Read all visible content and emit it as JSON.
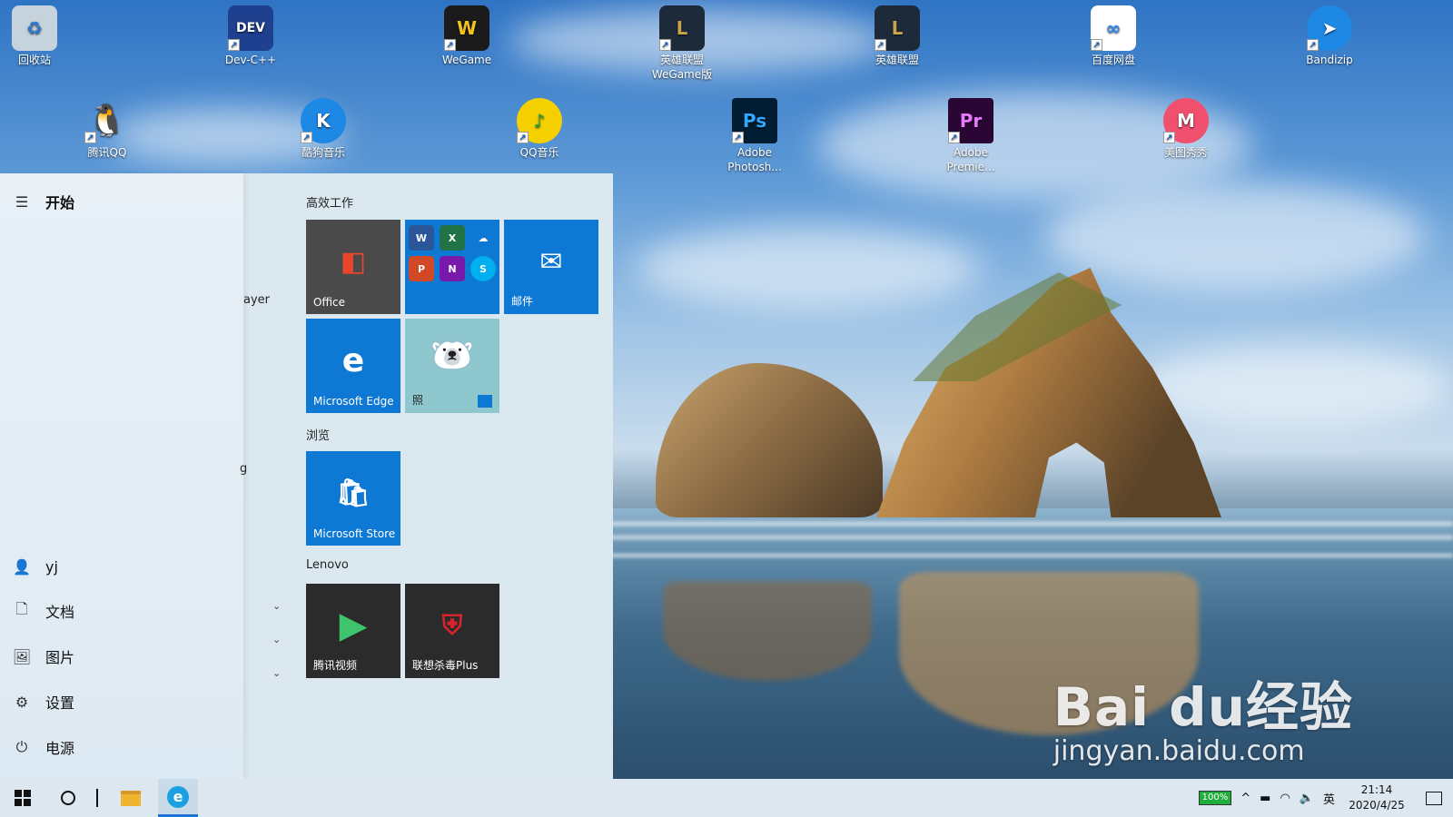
{
  "desktop_icons": [
    {
      "label": "回收站",
      "icon": "recycle-bin-icon",
      "color": "#c7d3dc"
    },
    {
      "label": "Dev-C++",
      "icon": "devcpp-icon",
      "color": "#1f3f8f"
    },
    {
      "label": "WeGame",
      "icon": "wegame-icon",
      "color": "#1b1b1b"
    },
    {
      "label": "英雄联盟",
      "label2": "WeGame版",
      "icon": "lol-icon",
      "color": "#1c2a3a"
    },
    {
      "label": "英雄联盟",
      "icon": "lol-icon",
      "color": "#1c2a3a"
    },
    {
      "label": "百度网盘",
      "icon": "baidu-netdisk-icon",
      "color": "#ffffff"
    },
    {
      "label": "Bandizip",
      "icon": "bandizip-icon",
      "color": "#1e88e5"
    },
    {
      "label": "腾讯QQ",
      "icon": "qq-icon",
      "color": "#111111"
    },
    {
      "label": "酷狗音乐",
      "icon": "kugou-icon",
      "color": "#1e88e5"
    },
    {
      "label": "QQ音乐",
      "icon": "qqmusic-icon",
      "color": "#f5d000"
    },
    {
      "label": "Adobe",
      "label2": "Photosh...",
      "icon": "photoshop-icon",
      "color": "#001d34",
      "glyph": "Ps",
      "glyph_color": "#31a8ff"
    },
    {
      "label": "Adobe",
      "label2": "Premie...",
      "icon": "premiere-icon",
      "color": "#2a0634",
      "glyph": "Pr",
      "glyph_color": "#ea77ff"
    },
    {
      "label": "美图秀秀",
      "icon": "meitu-icon",
      "color": "#f0506e"
    }
  ],
  "start_menu": {
    "title": "开始",
    "fragments": [
      "ayer",
      "g"
    ],
    "left_items": [
      {
        "label": "yj",
        "icon": "user-avatar-icon"
      },
      {
        "label": "文档",
        "icon": "document-icon"
      },
      {
        "label": "图片",
        "icon": "picture-icon"
      },
      {
        "label": "设置",
        "icon": "gear-icon"
      },
      {
        "label": "电源",
        "icon": "power-icon"
      }
    ],
    "groups": {
      "productivity": "高效工作",
      "browse": "浏览",
      "lenovo": "Lenovo"
    },
    "tiles": {
      "office": {
        "label": "Office",
        "color": "#4a4a4a"
      },
      "office_apps": {
        "color": "#0e78d5",
        "apps": [
          "W",
          "X",
          "☁",
          "P",
          "N",
          "S"
        ]
      },
      "mail": {
        "label": "邮件",
        "color": "#0e78d5"
      },
      "edge": {
        "label": "Microsoft Edge",
        "color": "#0e78d5"
      },
      "photos": {
        "label": "照",
        "color": "#8fc7cf"
      },
      "store": {
        "label": "Microsoft Store",
        "color": "#0e78d5"
      },
      "tencent_video": {
        "label": "腾讯视频",
        "color": "#2b2b2b"
      },
      "lenovo_av": {
        "label": "联想杀毒Plus",
        "color": "#2b2b2b"
      }
    }
  },
  "taskbar": {
    "battery": "100%",
    "ime": "英",
    "time": "21:14",
    "date": "2020/4/25"
  },
  "watermark": {
    "main": "Bai du经验",
    "sub": "jingyan.baidu.com"
  }
}
